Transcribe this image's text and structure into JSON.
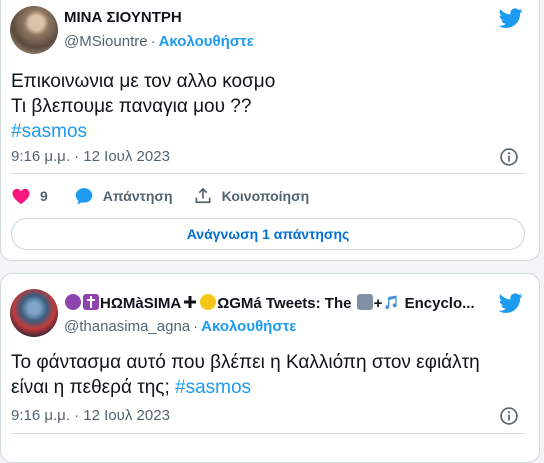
{
  "tweet1": {
    "name": "ΜΙΝΑ ΣΙΟΥΝΤΡΗ",
    "handle": "@MSiountre",
    "separator": "·",
    "follow_label": "Ακολουθήστε",
    "text_line1": "Επικοινωνια με τον αλλο κοσμο",
    "text_line2": "Τι βλεπουμε παναγια μου ??",
    "hashtag": "#sasmos",
    "time": "9:16 μ.μ. · 12 Ιουλ 2023",
    "likes": "9",
    "reply_label": "Απάντηση",
    "share_label": "Κοινοποίηση",
    "read_replies_label": "Ανάγνωση 1 απάντησης"
  },
  "tweet2": {
    "name_part1": "ΗΩΜàSIΜΑ",
    "name_part2": "ΩGΜá Tweets: The",
    "name_part3": "+",
    "name_part4": "Encyclo...",
    "handle": "@thanasima_agna",
    "separator": "·",
    "follow_label": "Ακολουθήστε",
    "text_line1": "Το φάντασμα αυτό που βλέπει η Καλλιόπη στον εφιάλτη",
    "text_line2": "είναι η πεθερά της;",
    "hashtag": "#sasmos",
    "time": "9:16 μ.μ. · 12 Ιουλ 2023"
  },
  "colors": {
    "accent": "#1d9bf0",
    "like": "#f91880",
    "muted": "#536471",
    "link": "#006fd6"
  },
  "icons": [
    "twitter-bird-icon",
    "info-icon",
    "heart-icon",
    "reply-bubble-icon",
    "share-icon",
    "devil-emoji-icon",
    "cross-emoji-icon",
    "plus-emoji-icon",
    "angel-emoji-icon",
    "tv-emoji-icon",
    "music-notes-emoji-icon"
  ]
}
